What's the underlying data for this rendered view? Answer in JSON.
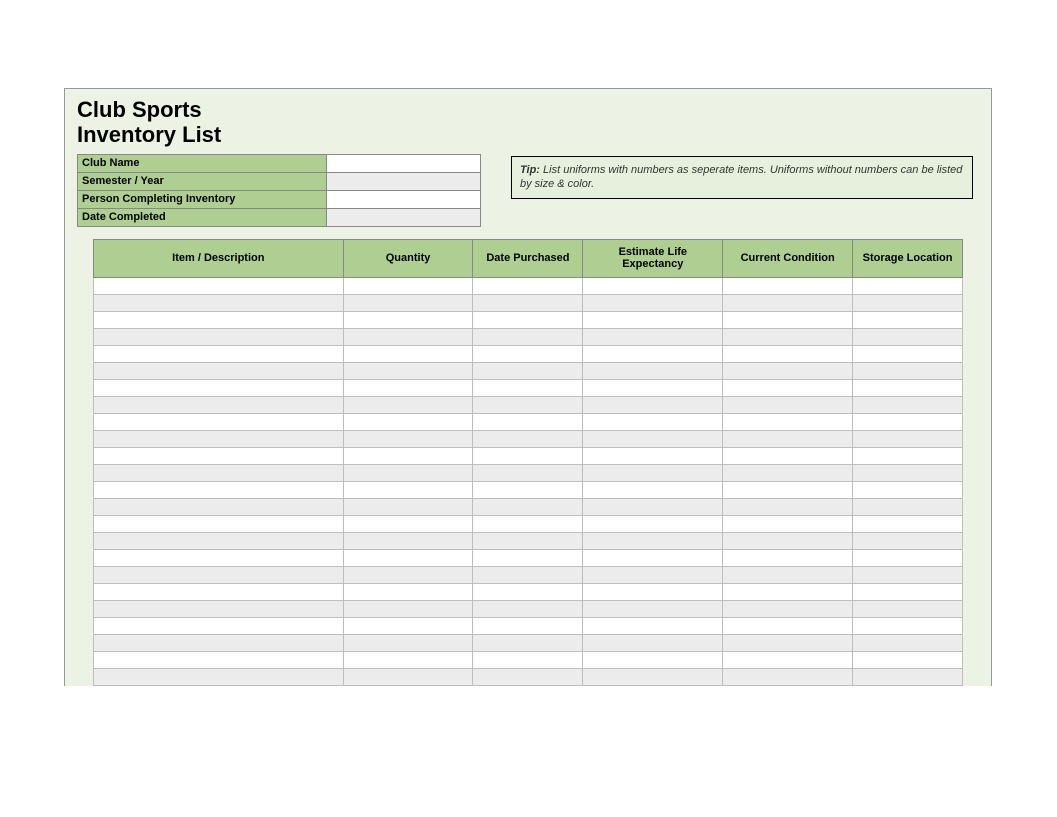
{
  "title": {
    "line1": "Club Sports",
    "line2": "Inventory List"
  },
  "meta": {
    "fields": [
      {
        "label": "Club Name",
        "value": "",
        "shade": "white"
      },
      {
        "label": "Semester / Year",
        "value": "",
        "shade": "gray"
      },
      {
        "label": "Person Completing Inventory",
        "value": "",
        "shade": "white"
      },
      {
        "label": "Date Completed",
        "value": "",
        "shade": "gray"
      }
    ]
  },
  "tip": {
    "label": "Tip:",
    "text": " List uniforms with numbers as seperate items. Uniforms without numbers can be listed by size & color."
  },
  "grid": {
    "columns": [
      "Item / Description",
      "Quantity",
      "Date Purchased",
      "Estimate Life Expectancy",
      "Current Condition",
      "Storage Location"
    ],
    "row_count": 24
  }
}
